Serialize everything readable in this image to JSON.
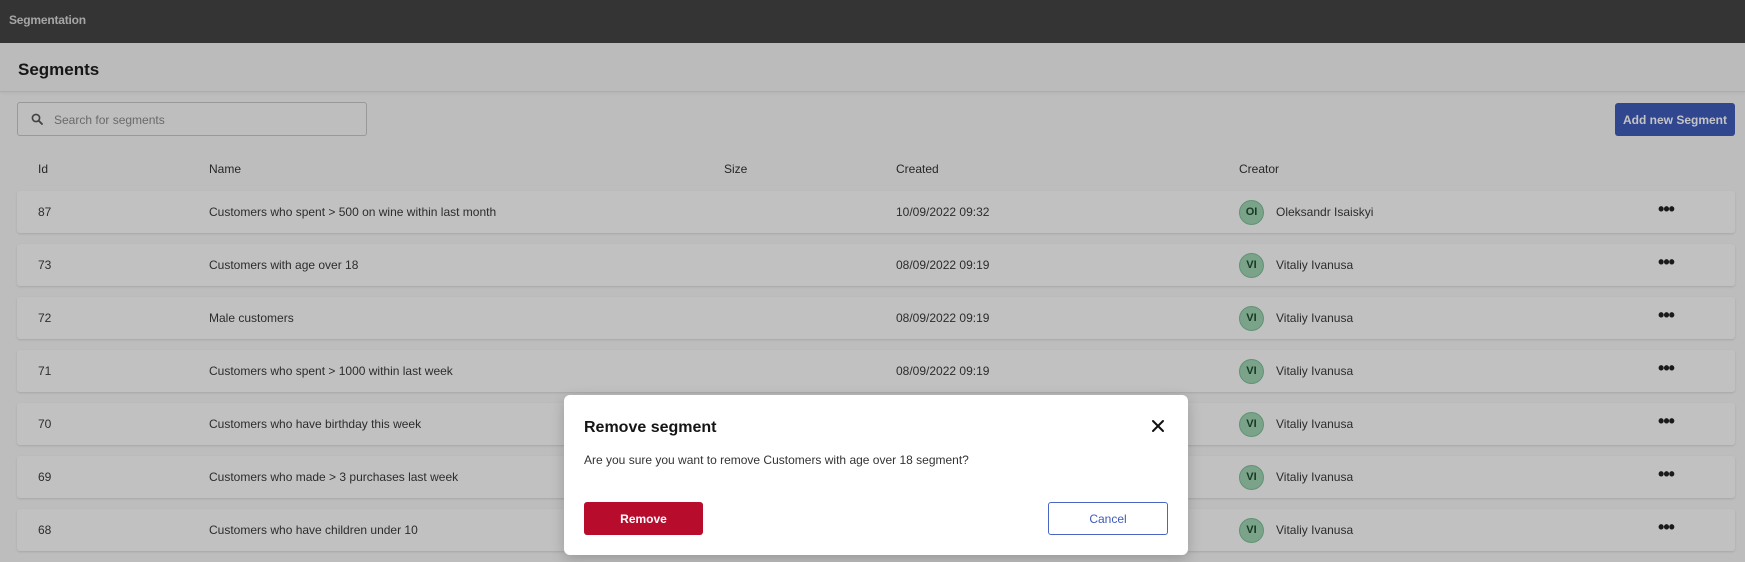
{
  "app": {
    "title": "Segmentation"
  },
  "page": {
    "title": "Segments"
  },
  "search": {
    "placeholder": "Search for segments",
    "value": ""
  },
  "toolbar": {
    "add_label": "Add new Segment"
  },
  "table": {
    "columns": [
      "Id",
      "Name",
      "Size",
      "Created",
      "Creator"
    ],
    "rows": [
      {
        "id": "87",
        "name": "Customers who spent > 500 on wine within last month",
        "size": "",
        "created": "10/09/2022 09:32",
        "initials": "OI",
        "creator": "Oleksandr Isaiskyi"
      },
      {
        "id": "73",
        "name": "Customers with age over 18",
        "size": "",
        "created": "08/09/2022 09:19",
        "initials": "VI",
        "creator": "Vitaliy Ivanusa"
      },
      {
        "id": "72",
        "name": "Male customers",
        "size": "",
        "created": "08/09/2022 09:19",
        "initials": "VI",
        "creator": "Vitaliy Ivanusa"
      },
      {
        "id": "71",
        "name": "Customers who spent > 1000 within last week",
        "size": "",
        "created": "08/09/2022 09:19",
        "initials": "VI",
        "creator": "Vitaliy Ivanusa"
      },
      {
        "id": "70",
        "name": "Customers who have birthday this week",
        "size": "",
        "created": "",
        "initials": "VI",
        "creator": "Vitaliy Ivanusa"
      },
      {
        "id": "69",
        "name": "Customers who made > 3 purchases last week",
        "size": "",
        "created": "",
        "initials": "VI",
        "creator": "Vitaliy Ivanusa"
      },
      {
        "id": "68",
        "name": "Customers who have children under 10",
        "size": "",
        "created": "",
        "initials": "VI",
        "creator": "Vitaliy Ivanusa"
      }
    ],
    "more_label": "•••"
  },
  "modal": {
    "title": "Remove segment",
    "body": "Are you sure you want to remove Customers with age over 18 segment?",
    "remove_label": "Remove",
    "cancel_label": "Cancel"
  },
  "icons": {
    "search": "search-icon",
    "close": "close-icon",
    "more": "more-horizontal-icon"
  },
  "colors": {
    "topbar": "#444444",
    "primary": "#3f5bb9",
    "danger": "#b80c2d",
    "avatar": "#9fd4b4"
  }
}
